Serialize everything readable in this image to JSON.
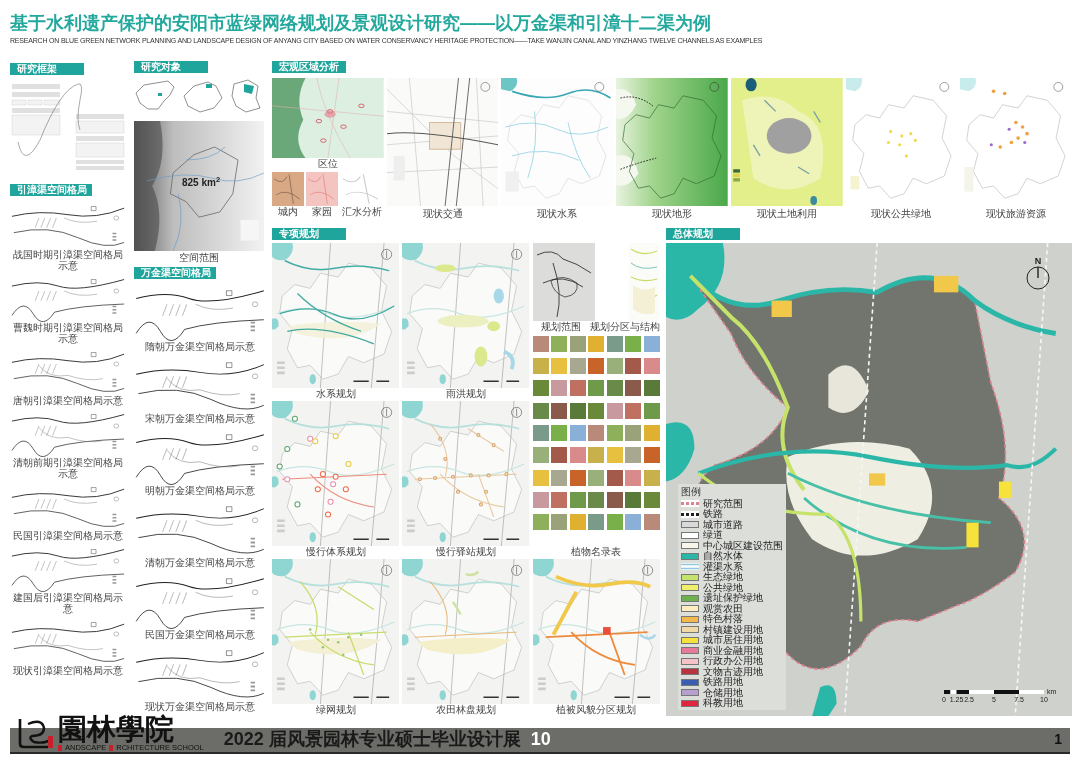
{
  "title": "基于水利遗产保护的安阳市蓝绿网络规划及景观设计研究——以万金渠和引漳十二渠为例",
  "subtitle": "RESEARCH ON BLUE GREEN NETWORK PLANNING AND LANDSCAPE DESIGN OF ANYANG CITY BASED ON WATER CONSERVANCY HERITAGE PROTECTION——TAKE WANJIN CANAL AND YINZHANG TWELVE CHANNELS AS EXAMPLES",
  "research_framework": {
    "heading": "研究框架"
  },
  "study_object": {
    "heading": "研究对象",
    "area": "825 km$^{2}$",
    "caption": "空间范围"
  },
  "yinzhang_layout": {
    "heading": "引漳渠空间格局",
    "diagrams": [
      {
        "caption": "战国时期引漳渠空间格局示意"
      },
      {
        "caption": "曹魏时期引漳渠空间格局示意"
      },
      {
        "caption": "唐朝引漳渠空间格局示意"
      },
      {
        "caption": "清朝前期引漳渠空间格局示意"
      },
      {
        "caption": "民国引漳渠空间格局示意"
      },
      {
        "caption": "建国后引漳渠空间格局示意"
      },
      {
        "caption": "现状引漳渠空间格局示意"
      }
    ]
  },
  "wanjin_layout": {
    "heading": "万金渠空间格局",
    "diagrams": [
      {
        "caption": "隋朝万金渠空间格局示意"
      },
      {
        "caption": "宋朝万金渠空间格局示意"
      },
      {
        "caption": "明朝万金渠空间格局示意"
      },
      {
        "caption": "清朝万金渠空间格局示意"
      },
      {
        "caption": "民国万金渠空间格局示意"
      },
      {
        "caption": "现状万金渠空间格局示意"
      }
    ]
  },
  "macro_analysis": {
    "heading": "宏观区域分析",
    "location": {
      "caption": "区位",
      "insets": [
        {
          "caption": "城内"
        },
        {
          "caption": "家园"
        },
        {
          "caption": "汇水分析"
        }
      ]
    },
    "maps": [
      {
        "kind": "traffic",
        "caption": "现状交通"
      },
      {
        "kind": "hydrology",
        "caption": "现状水系"
      },
      {
        "kind": "terrain",
        "caption": "现状地形"
      },
      {
        "kind": "landuse",
        "caption": "现状土地利用"
      },
      {
        "kind": "greenspace",
        "caption": "现状公共绿地"
      },
      {
        "kind": "tourism",
        "caption": "现状旅游资源"
      }
    ]
  },
  "special_planning": {
    "heading": "专项规划",
    "maps": [
      {
        "kind": "waterways",
        "caption": "水系规划"
      },
      {
        "kind": "stormwater",
        "caption": "雨洪规划"
      },
      {
        "kind": "trails",
        "caption": "慢行体系规划"
      },
      {
        "kind": "stations",
        "caption": "慢行驿站规划"
      },
      {
        "kind": "greenways",
        "caption": "绿网规划"
      },
      {
        "kind": "farmland",
        "caption": "农田林盘规划"
      },
      {
        "kind": "vegetation",
        "caption": "植被风貌分区规划"
      }
    ],
    "scope_caption": "规划范围",
    "structure_caption": "规划分区与结构",
    "plant_caption": "植物名录表"
  },
  "master_plan": {
    "heading": "总体规划",
    "north": "N",
    "legend_title": "图例",
    "legend": [
      {
        "kind": "dashed",
        "label": "研究范围",
        "color": "#d9848f"
      },
      {
        "kind": "dashed",
        "label": "铁路",
        "color": "#222222"
      },
      {
        "kind": "fill",
        "label": "城市道路",
        "color": "#d9d9d9"
      },
      {
        "kind": "fill",
        "label": "绿道",
        "color": "#ffffff"
      },
      {
        "kind": "fill",
        "label": "中心城区建设范围",
        "color": "#f7f5ec"
      },
      {
        "kind": "fill",
        "label": "自然水体",
        "color": "#2bb7a8"
      },
      {
        "kind": "lines",
        "label": "灌渠水系",
        "color": "#8fc8e0"
      },
      {
        "kind": "fill",
        "label": "生态绿地",
        "color": "#c5e26a"
      },
      {
        "kind": "fill",
        "label": "公共绿地",
        "color": "#f0ee6a"
      },
      {
        "kind": "fill",
        "label": "遗址保护绿地",
        "color": "#6db24f"
      },
      {
        "kind": "fill",
        "label": "观赏农田",
        "color": "#fbeec0"
      },
      {
        "kind": "fill",
        "label": "特色村落",
        "color": "#f2b84b"
      },
      {
        "kind": "fill",
        "label": "村镇建设用地",
        "color": "#f1d9a5"
      },
      {
        "kind": "fill",
        "label": "城市居住用地",
        "color": "#f7e23c"
      },
      {
        "kind": "fill",
        "label": "商业金融用地",
        "color": "#e8799a"
      },
      {
        "kind": "fill",
        "label": "行政办公用地",
        "color": "#f5c2c8"
      },
      {
        "kind": "fill",
        "label": "文物古迹用地",
        "color": "#b8333d"
      },
      {
        "kind": "fill",
        "label": "铁路用地",
        "color": "#3a5fb0"
      },
      {
        "kind": "fill",
        "label": "仓储用地",
        "color": "#b79fd0"
      },
      {
        "kind": "fill",
        "label": "科教用地",
        "color": "#e0263f"
      }
    ],
    "scale": {
      "ticks": [
        "0",
        "1.25",
        "2.5",
        "5",
        "7.5",
        "10"
      ],
      "unit": "km"
    }
  },
  "footer": {
    "school": "園林學院",
    "school_en": [
      "ANDSCAPE",
      "RCHITECTURE SCHOOL"
    ],
    "exhibition": "2022 届风景园林专业硕士毕业设计展",
    "number": "10",
    "page": "1"
  }
}
